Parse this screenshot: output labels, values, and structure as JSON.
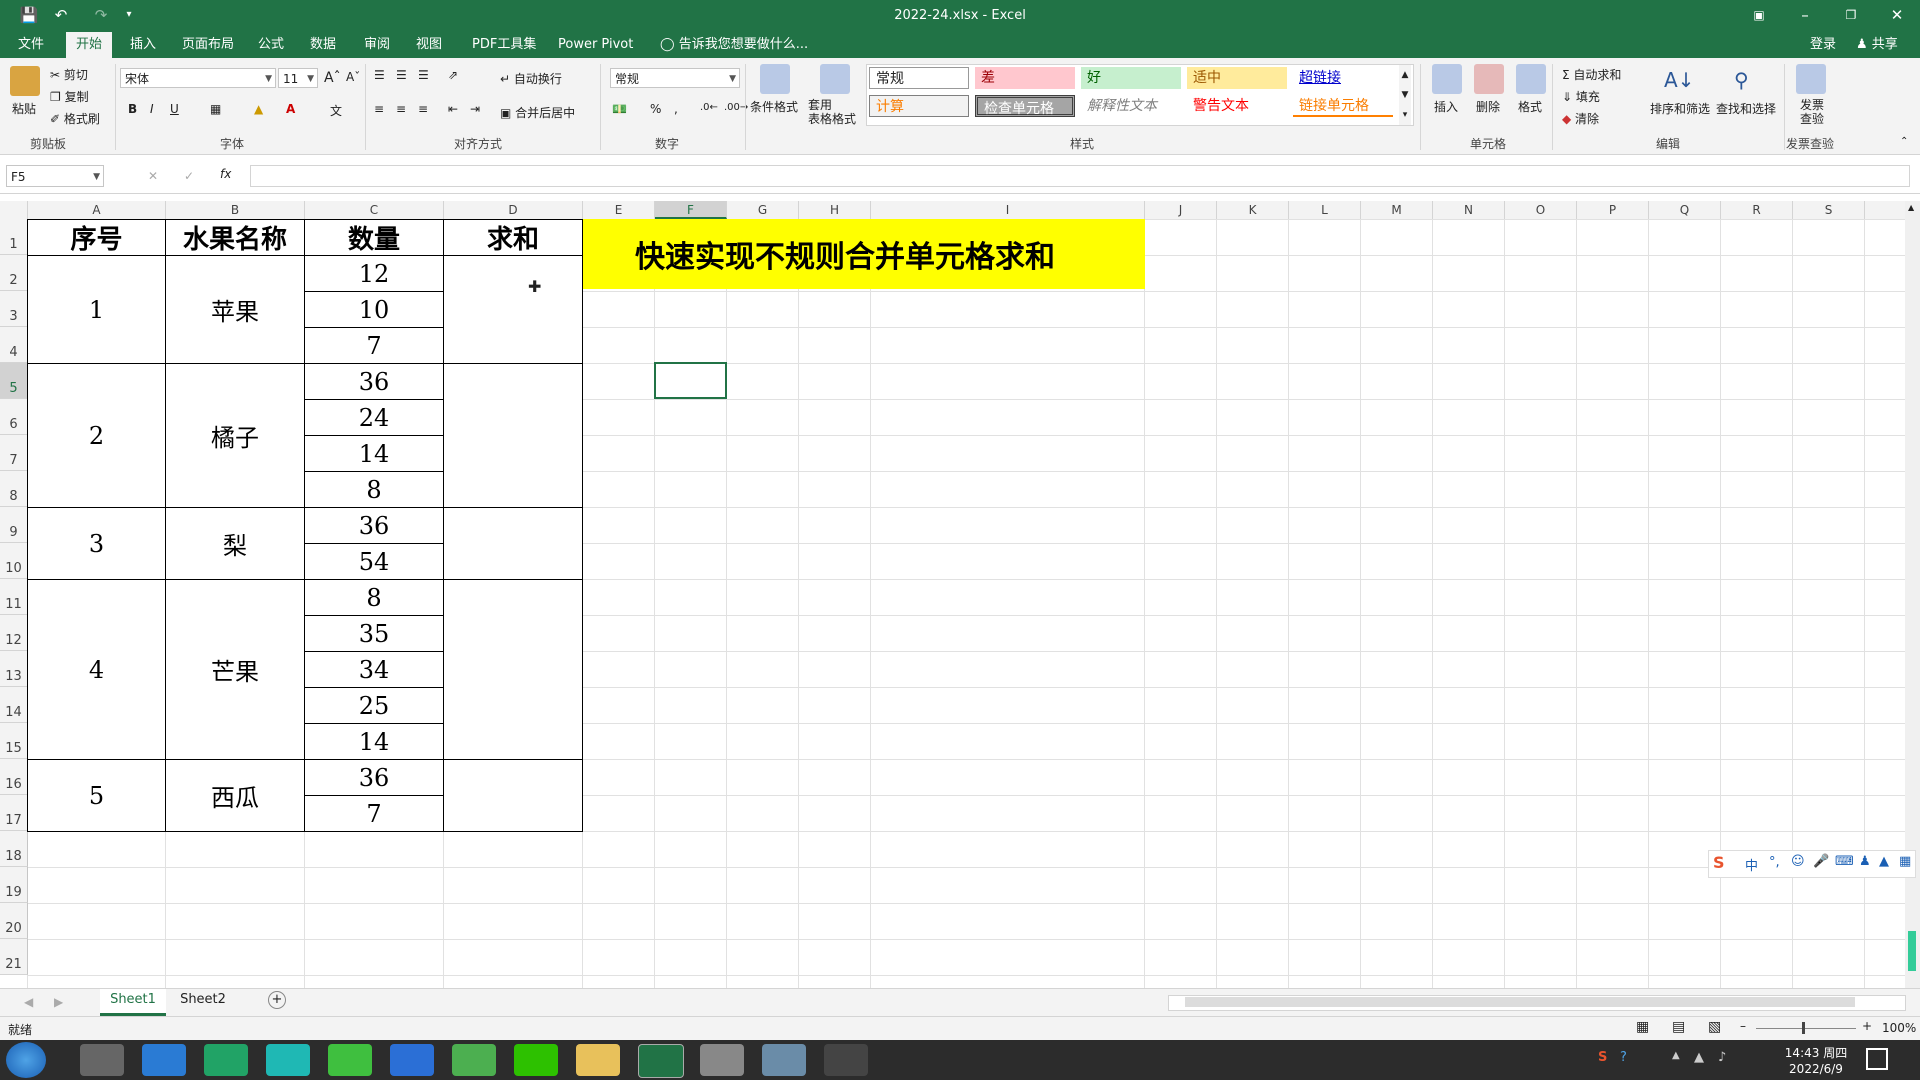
{
  "window": {
    "title": "2022-24.xlsx - Excel"
  },
  "tabs": [
    "文件",
    "开始",
    "插入",
    "页面布局",
    "公式",
    "数据",
    "审阅",
    "视图",
    "PDF工具集",
    "Power Pivot"
  ],
  "tell_me": "告诉我您想要做什么...",
  "account": {
    "login": "登录",
    "share": "共享"
  },
  "ribbon": {
    "clipboard": {
      "paste": "粘贴",
      "cut": "剪切",
      "copy": "复制",
      "format_painter": "格式刷",
      "label": "剪贴板"
    },
    "font": {
      "name": "宋体",
      "size": "11",
      "label": "字体",
      "bold": "B",
      "italic": "I",
      "underline": "U"
    },
    "alignment": {
      "wrap": "自动换行",
      "merge": "合并后居中",
      "label": "对齐方式"
    },
    "number": {
      "format": "常规",
      "percent": "%",
      "comma": ",",
      "label": "数字"
    },
    "styles": {
      "cond_format": "条件格式",
      "table_format": "套用\n表格格式",
      "cells": [
        "常规",
        "差",
        "好",
        "适中",
        "超链接",
        "计算",
        "检查单元格",
        "解释性文本",
        "警告文本",
        "链接单元格"
      ],
      "label": "样式"
    },
    "cells_grp": {
      "insert": "插入",
      "delete": "删除",
      "format": "格式",
      "label": "单元格"
    },
    "editing": {
      "autosum": "自动求和",
      "fill": "填充",
      "clear": "清除",
      "sort": "排序和筛选",
      "find": "查找和选择",
      "label": "编辑"
    },
    "invoice": {
      "check": "发票\n查验",
      "label": "发票查验"
    }
  },
  "name_box": "F5",
  "formula_fx": "fx",
  "columns": [
    "A",
    "B",
    "C",
    "D",
    "E",
    "F",
    "G",
    "H",
    "I",
    "J",
    "K",
    "L",
    "M",
    "N",
    "O",
    "P",
    "Q",
    "R",
    "S"
  ],
  "rows": [
    "1",
    "2",
    "3",
    "4",
    "5",
    "6",
    "7",
    "8",
    "9",
    "10",
    "11",
    "12",
    "13",
    "14",
    "15",
    "16",
    "17",
    "18",
    "19",
    "20",
    "21"
  ],
  "table": {
    "headers": [
      "序号",
      "水果名称",
      "数量",
      "求和"
    ],
    "groups": [
      {
        "id": "1",
        "fruit": "苹果",
        "qty": [
          "12",
          "10",
          "7"
        ]
      },
      {
        "id": "2",
        "fruit": "橘子",
        "qty": [
          "36",
          "24",
          "14",
          "8"
        ]
      },
      {
        "id": "3",
        "fruit": "梨",
        "qty": [
          "36",
          "54"
        ]
      },
      {
        "id": "4",
        "fruit": "芒果",
        "qty": [
          "8",
          "35",
          "34",
          "25",
          "14"
        ]
      },
      {
        "id": "5",
        "fruit": "西瓜",
        "qty": [
          "36",
          "7"
        ]
      }
    ]
  },
  "banner": "快速实现不规则合并单元格求和",
  "sheets": [
    "Sheet1",
    "Sheet2"
  ],
  "status": {
    "ready": "就绪",
    "zoom": "100%"
  },
  "ime": {
    "label": "中"
  },
  "clock": {
    "time": "14:43 周四",
    "date": "2022/6/9"
  },
  "colors": {
    "excel_green": "#217346",
    "banner_yellow": "#ffff00"
  }
}
